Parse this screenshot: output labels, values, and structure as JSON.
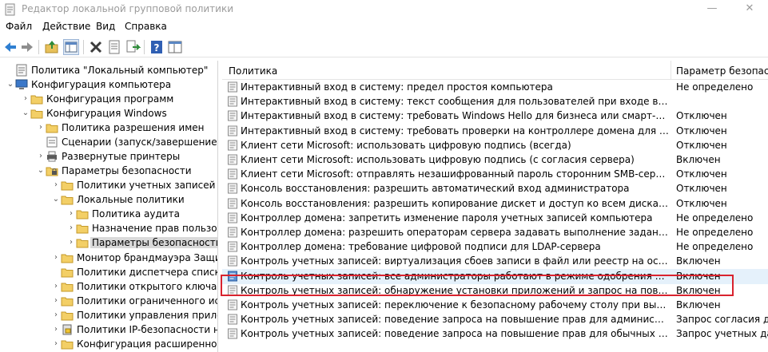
{
  "window": {
    "title": "Редактор локальной групповой политики",
    "minimize": "—",
    "close": "✕"
  },
  "menu": [
    "Файл",
    "Действие",
    "Вид",
    "Справка"
  ],
  "toolbar": [
    "back-icon",
    "forward-icon",
    "up-folder-icon",
    "show-tree-icon",
    "delete-icon",
    "properties-icon",
    "export-list-icon",
    "help-icon",
    "extended-view-icon"
  ],
  "tree": [
    {
      "label": "Политика \"Локальный компьютер\"",
      "icon": "policy-icon",
      "twisty": "",
      "level": 0
    },
    {
      "label": "Конфигурация компьютера",
      "icon": "computer-icon",
      "twisty": "expanded",
      "level": 0
    },
    {
      "label": "Конфигурация программ",
      "icon": "folder-icon",
      "twisty": "collapsed",
      "level": 1
    },
    {
      "label": "Конфигурация Windows",
      "icon": "folder-icon",
      "twisty": "expanded",
      "level": 1
    },
    {
      "label": "Политика разрешения имен",
      "icon": "folder-icon",
      "twisty": "collapsed",
      "level": 2
    },
    {
      "label": "Сценарии (запуск/завершение)",
      "icon": "scripts-icon",
      "twisty": "",
      "level": 2
    },
    {
      "label": "Развернутые принтеры",
      "icon": "printer-icon",
      "twisty": "collapsed",
      "level": 2
    },
    {
      "label": "Параметры безопасности",
      "icon": "security-folder-icon",
      "twisty": "expanded",
      "level": 2
    },
    {
      "label": "Политики учетных записей",
      "icon": "folder-icon",
      "twisty": "collapsed",
      "level": 3
    },
    {
      "label": "Локальные политики",
      "icon": "folder-icon",
      "twisty": "expanded",
      "level": 3
    },
    {
      "label": "Политика аудита",
      "icon": "folder-icon",
      "twisty": "collapsed",
      "level": 4
    },
    {
      "label": "Назначение прав пользовател",
      "icon": "folder-icon",
      "twisty": "collapsed",
      "level": 4
    },
    {
      "label": "Параметры безопасности",
      "icon": "folder-icon",
      "twisty": "collapsed",
      "level": 4,
      "selected": true
    },
    {
      "label": "Монитор брандмауэра Защитн",
      "icon": "folder-icon",
      "twisty": "collapsed",
      "level": 3
    },
    {
      "label": "Политики диспетчера списка с",
      "icon": "folder-icon",
      "twisty": "",
      "level": 3
    },
    {
      "label": "Политики открытого ключа",
      "icon": "folder-icon",
      "twisty": "collapsed",
      "level": 3
    },
    {
      "label": "Политики ограниченного испо",
      "icon": "folder-icon",
      "twisty": "collapsed",
      "level": 3
    },
    {
      "label": "Политики управления приложе",
      "icon": "folder-icon",
      "twisty": "collapsed",
      "level": 3
    },
    {
      "label": "Политики IP-безопасности на \"",
      "icon": "ipsec-icon",
      "twisty": "collapsed",
      "level": 3
    },
    {
      "label": "Конфигурация расширенной п",
      "icon": "folder-icon",
      "twisty": "collapsed",
      "level": 3
    }
  ],
  "list": {
    "col_policy": "Политика",
    "col_setting": "Параметр безопасно",
    "rows": [
      {
        "name": "Интерактивный вход в систему: предел простоя компьютера",
        "value": "Не определено"
      },
      {
        "name": "Интерактивный вход в систему: текст сообщения для пользователей при входе в систему",
        "value": ""
      },
      {
        "name": "Интерактивный вход в систему: требовать Windows Hello для бизнеса или смарт-карту",
        "value": "Отключен"
      },
      {
        "name": "Интерактивный вход в систему: требовать проверки на контроллере домена для отмены блок...",
        "value": "Отключен"
      },
      {
        "name": "Клиент сети Microsoft: использовать цифровую подпись (всегда)",
        "value": "Отключен"
      },
      {
        "name": "Клиент сети Microsoft: использовать цифровую подпись (с согласия сервера)",
        "value": "Включен"
      },
      {
        "name": "Клиент сети Microsoft: отправлять незашифрованный пароль сторонним SMB-серверам",
        "value": "Отключен"
      },
      {
        "name": "Консоль восстановления: разрешить автоматический вход администратора",
        "value": "Отключен"
      },
      {
        "name": "Консоль восстановления: разрешить копирование дискет и доступ ко всем дискам и папкам",
        "value": "Отключен"
      },
      {
        "name": "Контроллер домена: запретить изменение пароля учетных записей компьютера",
        "value": "Не определено"
      },
      {
        "name": "Контроллер домена: разрешить операторам сервера задавать выполнение заданий по расписа...",
        "value": "Не определено"
      },
      {
        "name": "Контроллер домена: требование цифровой подписи для LDAP-сервера",
        "value": "Не определено"
      },
      {
        "name": "Контроль учетных записей: виртуализация сбоев записи в файл или реестр на основании расп...",
        "value": "Включен"
      },
      {
        "name": "Контроль учетных записей: все администраторы работают в режиме одобрения администрато...",
        "value": "Включен",
        "selected": true
      },
      {
        "name": "Контроль учетных записей: обнаружение установки приложений и запрос на повышение прав",
        "value": "Включен"
      },
      {
        "name": "Контроль учетных записей: переключение к безопасному рабочему столу при выполнении за...",
        "value": "Включен"
      },
      {
        "name": "Контроль учетных записей: поведение запроса на повышение прав для администраторов в р...",
        "value": "Запрос согласия для"
      },
      {
        "name": "Контроль учетных записей: поведение запроса на повышение прав для обычных пользовате...",
        "value": "Запрос учетных данн"
      }
    ]
  },
  "colors": {
    "highlight": "#d9232e",
    "selected_row": "#e5f1fb",
    "tree_selected": "#d9d9d9"
  }
}
